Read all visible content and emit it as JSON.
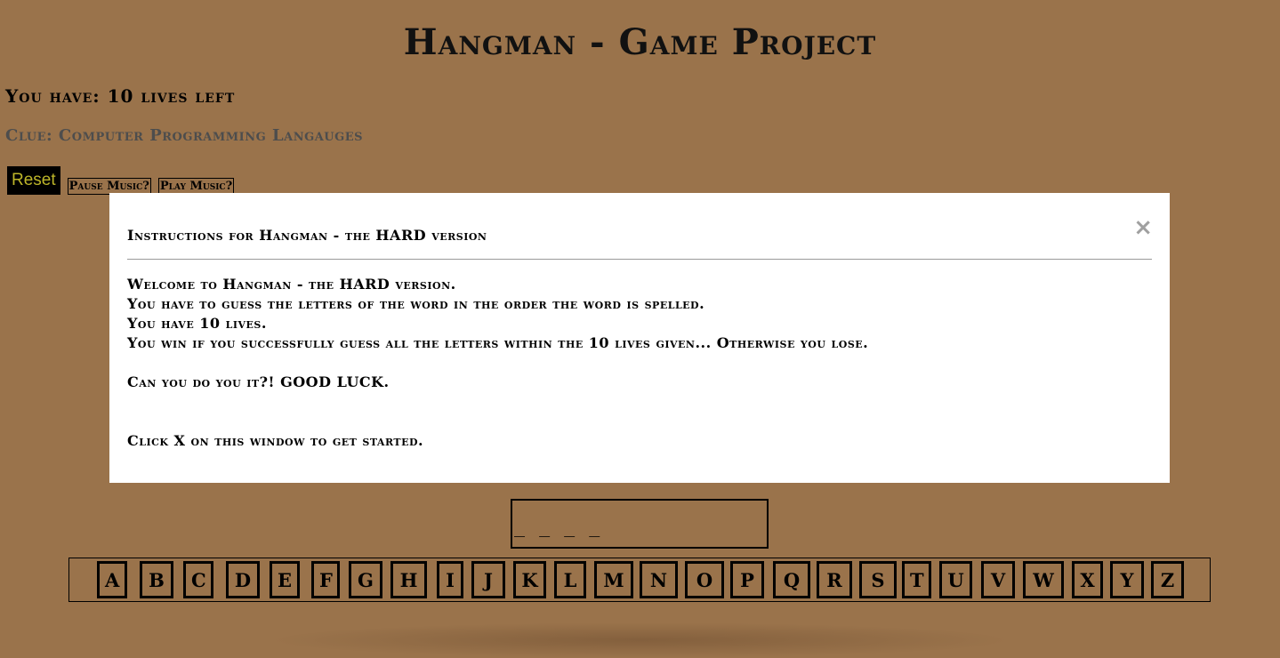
{
  "header": {
    "title": "Hangman - Game Project",
    "lives_text": "You have: 10 lives left",
    "clue_text": "Clue: Computer Programming Langauges"
  },
  "controls": {
    "reset_label": "Reset",
    "pause_label": "Pause Music?",
    "play_label": "Play Music?"
  },
  "modal": {
    "title": "Instructions for Hangman - the HARD version",
    "close_label": "×",
    "line1": "Welcome to Hangman - the HARD version.",
    "line2": "You have to guess the letters of the word in the order the word is spelled.",
    "line3": "You have 10 lives.",
    "line4": "You win if you successfully guess all the letters within the 10 lives given... Otherwise you lose.",
    "line5": "Can you do you it?! GOOD LUCK.",
    "line6": "Click X on this window to get started."
  },
  "word": {
    "display": "_ _ _ _"
  },
  "letters": [
    "A",
    "B",
    "C",
    "D",
    "E",
    "F",
    "G",
    "H",
    "I",
    "J",
    "K",
    "L",
    "M",
    "N",
    "O",
    "P",
    "Q",
    "R",
    "S",
    "T",
    "U",
    "V",
    "W",
    "X",
    "Y",
    "Z"
  ],
  "colors": {
    "background": "#9a734b",
    "reset_text": "#bdb529",
    "clue_text": "#4d4d4d",
    "close_icon": "#a0a0a0"
  }
}
